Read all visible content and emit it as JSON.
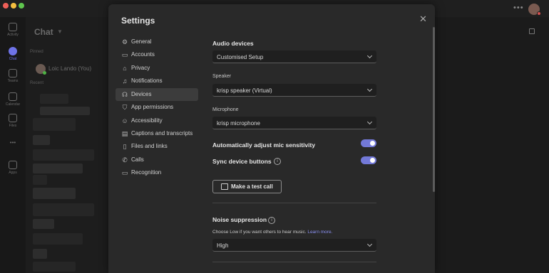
{
  "rail": {
    "items": [
      {
        "label": "Activity",
        "icon": "bell-icon",
        "active": false
      },
      {
        "label": "Chat",
        "icon": "chat-icon",
        "active": true
      },
      {
        "label": "Teams",
        "icon": "teams-icon",
        "active": false
      },
      {
        "label": "Calendar",
        "icon": "calendar-icon",
        "active": false
      },
      {
        "label": "Files",
        "icon": "files-icon",
        "active": false
      },
      {
        "label": "Apps",
        "icon": "apps-icon",
        "active": false
      }
    ]
  },
  "chat": {
    "title": "Chat",
    "pinned_label": "Pinned",
    "recent_label": "Recent",
    "me_name": "Loic Lando (You)"
  },
  "settings": {
    "title": "Settings",
    "nav": [
      {
        "label": "General",
        "icon": "gear-icon",
        "glyph": "⚙"
      },
      {
        "label": "Accounts",
        "icon": "accounts-icon",
        "glyph": "▭"
      },
      {
        "label": "Privacy",
        "icon": "lock-icon",
        "glyph": "⌂"
      },
      {
        "label": "Notifications",
        "icon": "bell-icon",
        "glyph": "♫"
      },
      {
        "label": "Devices",
        "icon": "headset-icon",
        "glyph": "☊",
        "active": true
      },
      {
        "label": "App permissions",
        "icon": "shield-icon",
        "glyph": "⛉"
      },
      {
        "label": "Accessibility",
        "icon": "accessibility-icon",
        "glyph": "☺"
      },
      {
        "label": "Captions and transcripts",
        "icon": "captions-icon",
        "glyph": "▤"
      },
      {
        "label": "Files and links",
        "icon": "file-icon",
        "glyph": "▯"
      },
      {
        "label": "Calls",
        "icon": "phone-icon",
        "glyph": "✆"
      },
      {
        "label": "Recognition",
        "icon": "recognition-icon",
        "glyph": "▭"
      }
    ],
    "audio_devices": {
      "heading": "Audio devices",
      "value": "Customised Setup"
    },
    "speaker": {
      "label": "Speaker",
      "value": "krisp speaker (Virtual)"
    },
    "microphone": {
      "label": "Microphone",
      "value": "krisp microphone"
    },
    "auto_adjust": {
      "label": "Automatically adjust mic sensitivity",
      "on": true
    },
    "sync_buttons": {
      "label": "Sync device buttons",
      "on": true
    },
    "test_call_button": "Make a test call",
    "noise": {
      "heading": "Noise suppression",
      "help_text": "Choose Low if you want others to hear music.",
      "learn_more": "Learn more.",
      "value": "High"
    }
  },
  "colors": {
    "accent": "#7379d8",
    "background": "#1b1b1b",
    "modal": "#292929"
  }
}
